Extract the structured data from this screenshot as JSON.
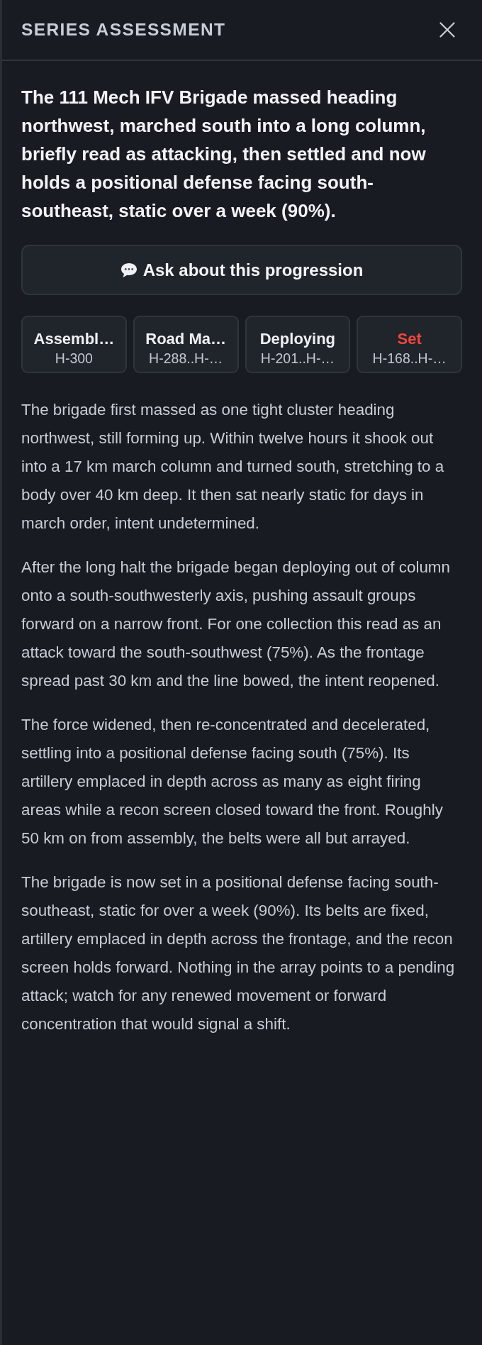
{
  "panel": {
    "title": "SERIES ASSESSMENT"
  },
  "summary": "The 111 Mech IFV Brigade massed heading northwest, marched south into a long column, briefly read as attacking, then settled and now holds a positional defense facing south-southeast, static over a week (90%).",
  "ask_button": {
    "label": "Ask about this progression"
  },
  "stages": [
    {
      "label": "Assembl…",
      "range": "H-300",
      "selected": false
    },
    {
      "label": "Road Ma…",
      "range": "H-288..H-…",
      "selected": false
    },
    {
      "label": "Deploying",
      "range": "H-201..H-…",
      "selected": false
    },
    {
      "label": "Set",
      "range": "H-168..H-…",
      "selected": true
    }
  ],
  "paragraphs": [
    "The brigade first massed as one tight cluster heading northwest, still forming up. Within twelve hours it shook out into a 17 km march column and turned south, stretching to a body over 40 km deep. It then sat nearly static for days in march order, intent undetermined.",
    "After the long halt the brigade began deploying out of column onto a south-southwesterly axis, pushing assault groups forward on a narrow front. For one collection this read as an attack toward the south-southwest (75%). As the frontage spread past 30 km and the line bowed, the intent reopened.",
    "The force widened, then re-concentrated and decelerated, settling into a positional defense facing south (75%). Its artillery emplaced in depth across as many as eight firing areas while a recon screen closed toward the front. Roughly 50 km on from assembly, the belts were all but arrayed.",
    "The brigade is now set in a positional defense facing south-southeast, static for over a week (90%). Its belts are fixed, artillery emplaced in depth across the frontage, and the recon screen holds forward. Nothing in the array points to a pending attack; watch for any renewed movement or forward concentration that would signal a shift."
  ]
}
